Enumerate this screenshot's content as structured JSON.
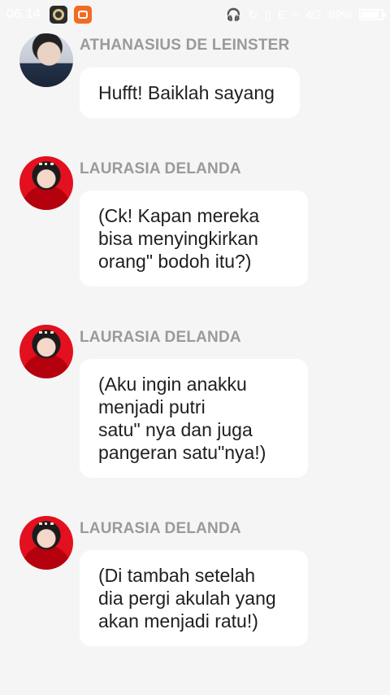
{
  "status_bar": {
    "time": "06.14",
    "network": "4G",
    "signal_e": "E",
    "battery": "89%",
    "battery_level": 0.89,
    "icons": [
      "music-app-icon",
      "camera-app-icon",
      "headphones-icon",
      "sync-icon",
      "vibrate-icon",
      "signal-icon",
      "wifi-icon",
      "battery-icon"
    ]
  },
  "messages": [
    {
      "sender": "ATHANASIUS DE LEINSTER",
      "avatar": "male-avatar",
      "lines": [
        "Hufft! Baiklah sayang"
      ]
    },
    {
      "sender": "LAURASIA DELANDA",
      "avatar": "female-avatar",
      "lines": [
        "(Ck! Kapan mereka",
        "bisa menyingkirkan",
        "orang\" bodoh itu?)"
      ]
    },
    {
      "sender": "LAURASIA DELANDA",
      "avatar": "female-avatar",
      "lines": [
        "(Aku ingin anakku",
        "menjadi putri",
        "satu\" nya dan juga",
        "pangeran satu\"nya!)"
      ]
    },
    {
      "sender": "LAURASIA DELANDA",
      "avatar": "female-avatar",
      "lines": [
        "(Di tambah setelah",
        "dia pergi akulah yang",
        "akan menjadi ratu!)"
      ]
    }
  ]
}
